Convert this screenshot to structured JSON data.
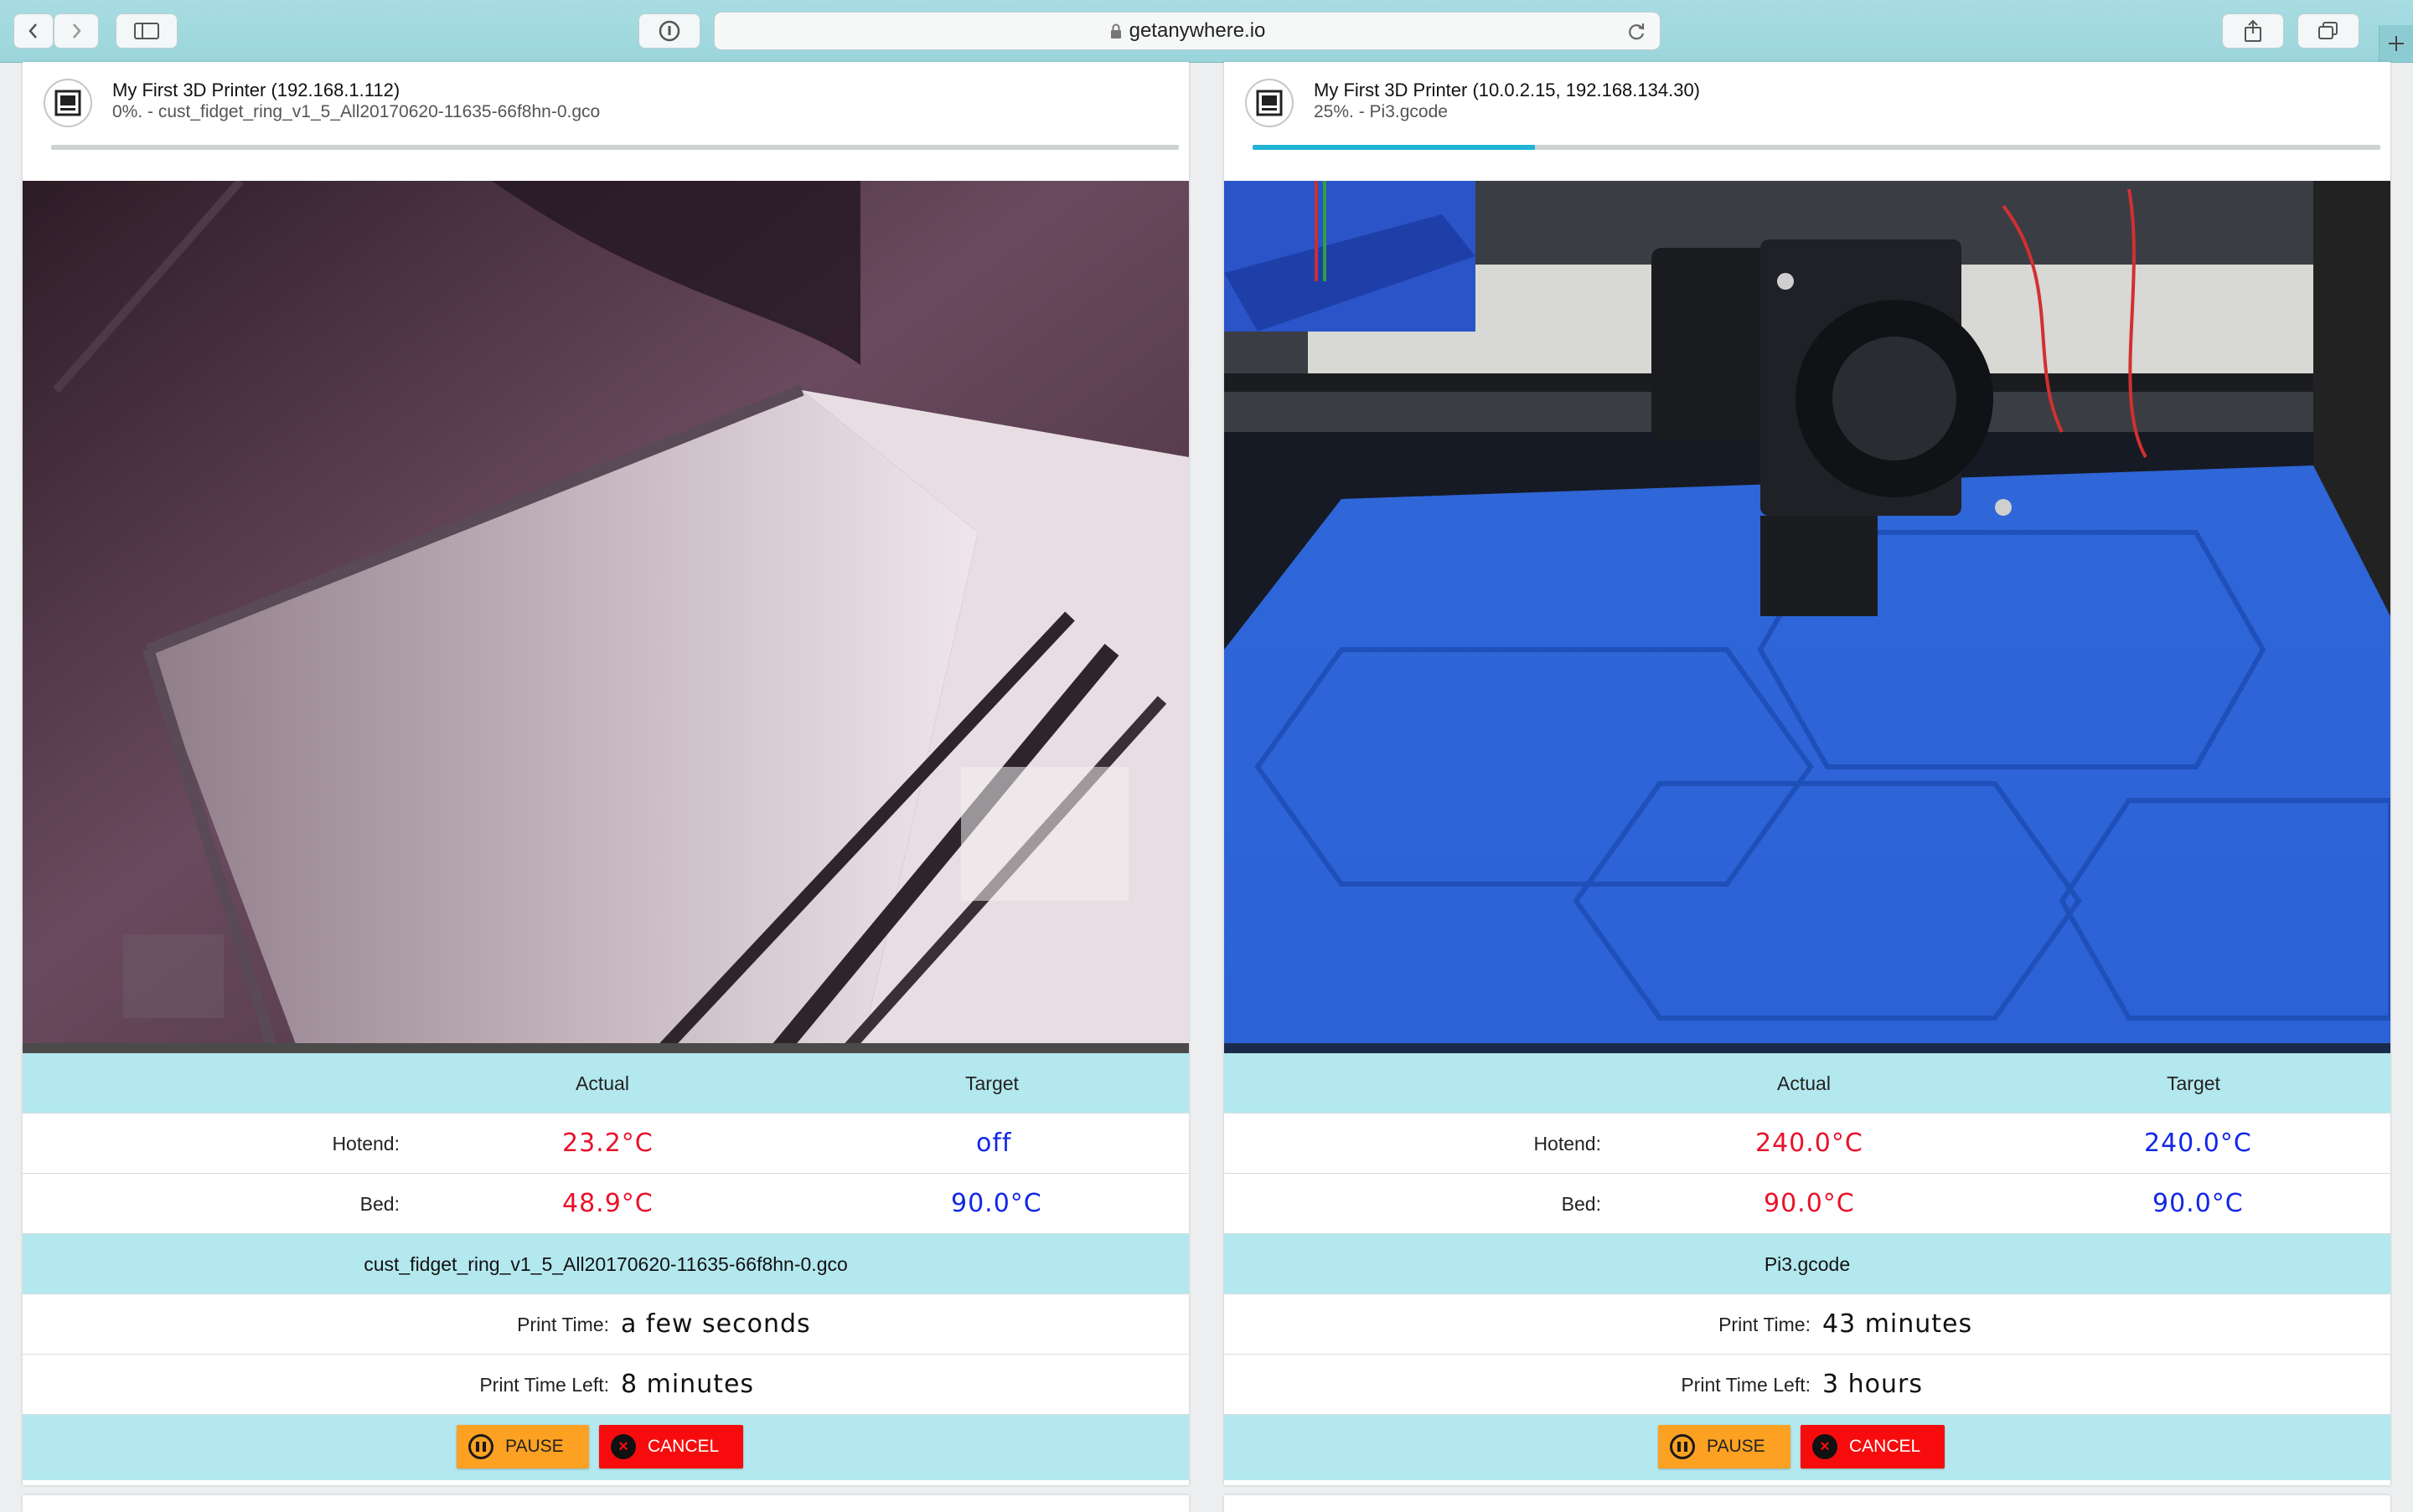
{
  "browser": {
    "url": "getanywhere.io",
    "icons": [
      "back-icon",
      "forward-icon",
      "sidebar-icon",
      "info-icon",
      "lock-icon",
      "reload-icon",
      "share-icon",
      "tabs-icon",
      "plus-icon"
    ]
  },
  "table_headers": {
    "actual": "Actual",
    "target": "Target"
  },
  "labels": {
    "hotend": "Hotend:",
    "bed": "Bed:",
    "print_time": "Print Time:",
    "print_time_left": "Print Time Left:",
    "pause": "PAUSE",
    "cancel": "CANCEL"
  },
  "colors": {
    "actual": "#e8122a",
    "target": "#1227e6",
    "header_bg": "#b4e8ef",
    "pause": "#fca122",
    "cancel": "#f80b0d",
    "progress": "#20b3d6"
  },
  "printers": [
    {
      "name": "My First 3D Printer (192.168.1.112)",
      "status": "0%. - cust_fidget_ring_v1_5_All20170620-11635-66f8hn-0.gco",
      "progress_percent": 0,
      "hotend_actual": "23.2°C",
      "hotend_target": "off",
      "bed_actual": "48.9°C",
      "bed_target": "90.0°C",
      "file": "cust_fidget_ring_v1_5_All20170620-11635-66f8hn-0.gco",
      "print_time": "a few seconds",
      "print_time_left": "8 minutes"
    },
    {
      "name": "My First 3D Printer (10.0.2.15, 192.168.134.30)",
      "status": "25%. - Pi3.gcode",
      "progress_percent": 25,
      "hotend_actual": "240.0°C",
      "hotend_target": "240.0°C",
      "bed_actual": "90.0°C",
      "bed_target": "90.0°C",
      "file": "Pi3.gcode",
      "print_time": "43 minutes",
      "print_time_left": "3 hours"
    }
  ]
}
